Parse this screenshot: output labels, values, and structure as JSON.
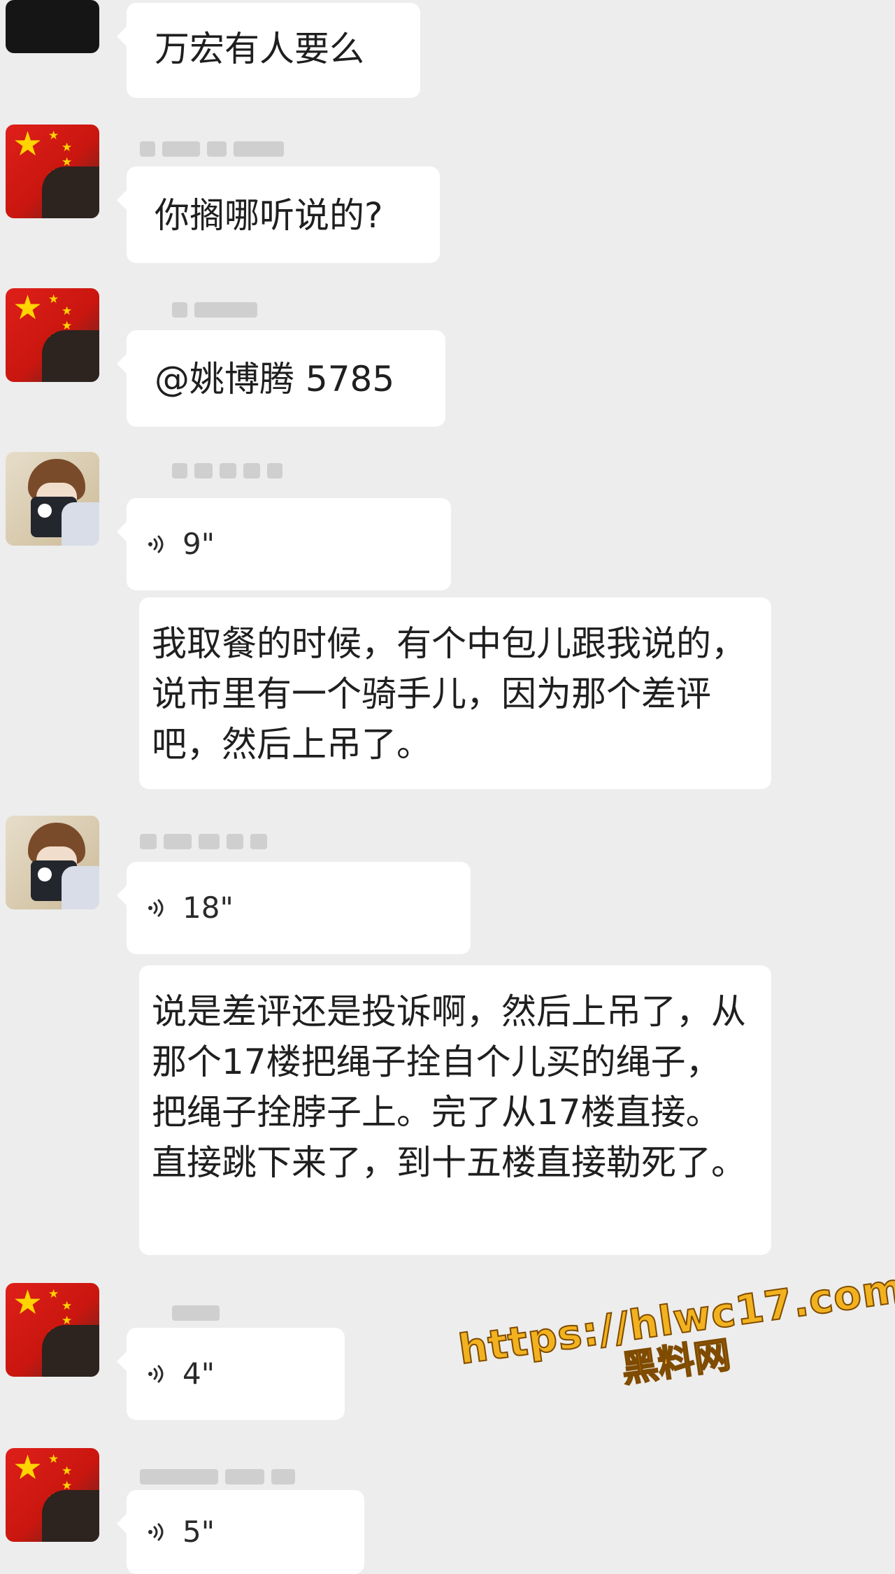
{
  "messages": [
    {
      "text": "万宏有人要么"
    },
    {
      "text": "你搁哪听说的?"
    },
    {
      "text": "@姚博腾 5785"
    },
    {
      "duration": "9\""
    },
    {
      "text": "我取餐的时候，有个中包儿跟我说的，说市里有一个骑手儿，因为那个差评吧，然后上吊了。"
    },
    {
      "duration": "18\""
    },
    {
      "text": "说是差评还是投诉啊，然后上吊了，从那个17楼把绳子拴自个儿买的绳子，把绳子拴脖子上。完了从17楼直接。直接跳下来了，到十五楼直接勒死了。"
    },
    {
      "duration": "4\""
    },
    {
      "duration": "5\""
    }
  ],
  "watermark": {
    "url": "https://hlwc17.com",
    "site": "黑料网"
  },
  "colors": {
    "background": "#ededed",
    "bubble": "#ffffff",
    "text": "#1f1f1f",
    "watermark": "#f2b21f"
  },
  "icons": {
    "voice": "voice-wave-icon",
    "avatar_flag": "flag-avatar",
    "avatar_photo": "person-photo-avatar"
  }
}
